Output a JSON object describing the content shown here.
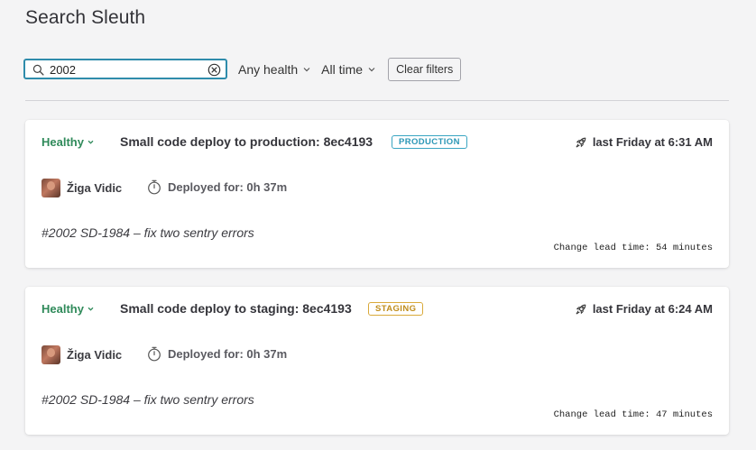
{
  "page": {
    "title": "Search Sleuth"
  },
  "filters": {
    "search_value": "2002",
    "search_placeholder": "",
    "health_label": "Any health",
    "time_label": "All time",
    "clear_label": "Clear filters"
  },
  "deploys": [
    {
      "health": "Healthy",
      "title": "Small code deploy to production: 8ec4193",
      "environment": "PRODUCTION",
      "time": "last Friday at 6:31 AM",
      "author": "Žiga Vidic",
      "duration": "Deployed for: 0h 37m",
      "commit": "#2002 SD-1984 – fix two sentry errors",
      "lead_time": "Change lead time: 54 minutes"
    },
    {
      "health": "Healthy",
      "title": "Small code deploy to staging: 8ec4193",
      "environment": "STAGING",
      "time": "last Friday at 6:24 AM",
      "author": "Žiga Vidic",
      "duration": "Deployed for: 0h 37m",
      "commit": "#2002 SD-1984 – fix two sentry errors",
      "lead_time": "Change lead time: 47 minutes"
    }
  ],
  "colors": {
    "healthy": "#2f8a5a",
    "production": "#2b97b6",
    "staging": "#c08d1c",
    "focus": "#2f8cab"
  },
  "icons": [
    "search-icon",
    "clear-circle-icon",
    "chevron-down-icon",
    "rocket-icon",
    "timer-icon"
  ]
}
